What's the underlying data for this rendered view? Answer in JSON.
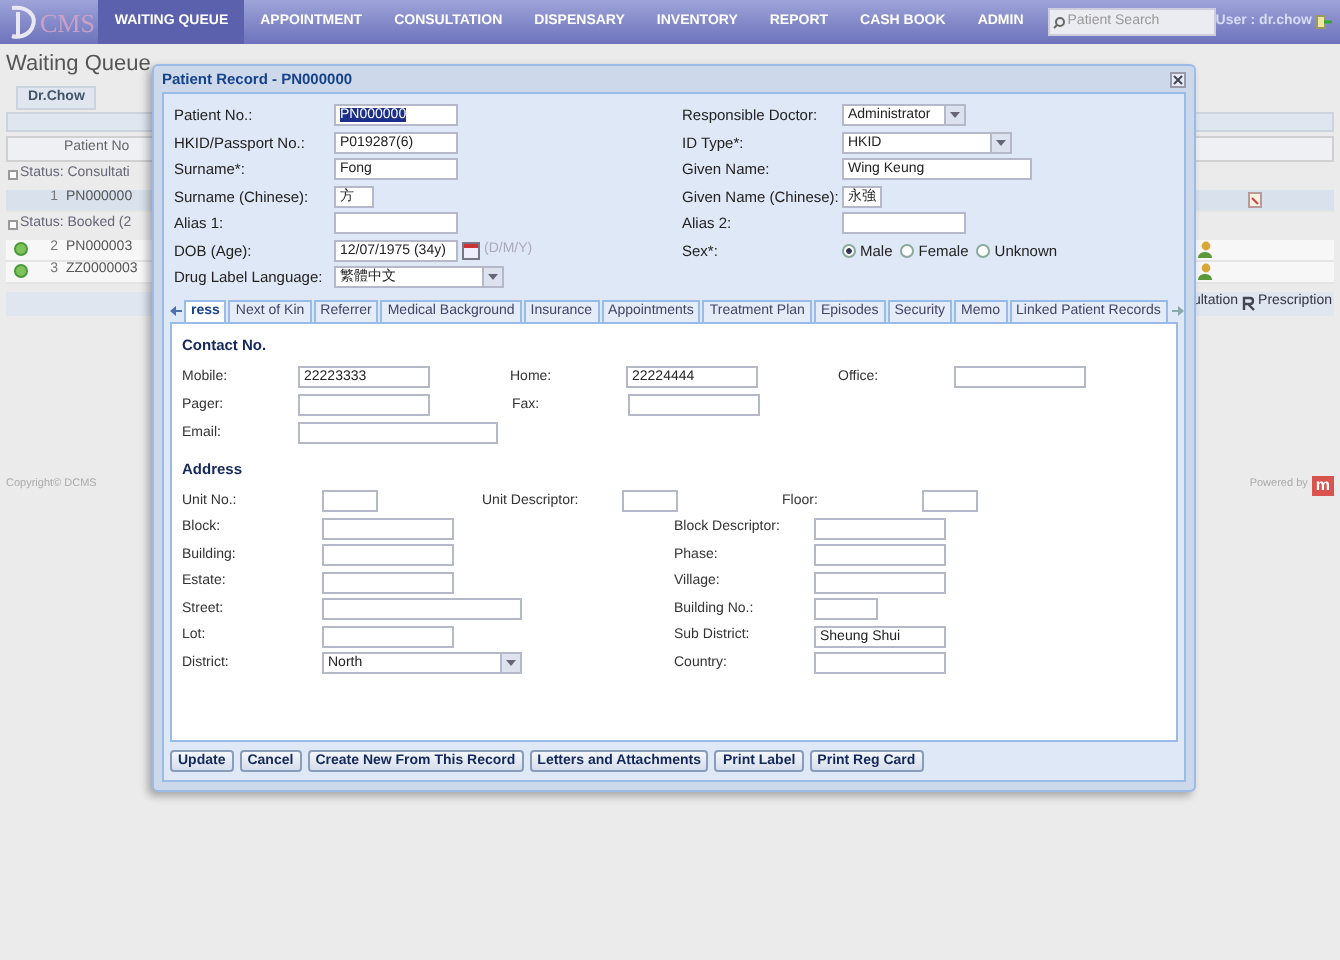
{
  "header": {
    "logo": "CMS",
    "nav": [
      {
        "label": "WAITING QUEUE",
        "selected": true
      },
      {
        "label": "APPOINTMENT",
        "selected": false
      },
      {
        "label": "CONSULTATION",
        "selected": false
      },
      {
        "label": "DISPENSARY",
        "selected": false
      },
      {
        "label": "INVENTORY",
        "selected": false
      },
      {
        "label": "REPORT",
        "selected": false
      },
      {
        "label": "CASH BOOK",
        "selected": false
      },
      {
        "label": "ADMIN",
        "selected": false
      }
    ],
    "search": {
      "placeholder": "Patient Search"
    },
    "user": "User : dr.chow"
  },
  "page": {
    "title": "Waiting Queue",
    "tabs": [
      {
        "label": "Dr.Chow",
        "selected": true
      }
    ],
    "grid": {
      "column": "Patient No",
      "groups": [
        {
          "title": "Status: Consultati",
          "rows": [
            {
              "number": "1",
              "patient_no": "PN000000",
              "selected": true,
              "kind": "note"
            }
          ]
        },
        {
          "title": "Status: Booked (2",
          "rows": [
            {
              "number": "2",
              "patient_no": "PN000003",
              "selected": false,
              "kind": "person"
            },
            {
              "number": "3",
              "patient_no": "ZZ0000003",
              "selected": false,
              "kind": "person"
            }
          ]
        }
      ],
      "toolbar": [
        "ultation",
        "Prescription"
      ]
    },
    "footer": {
      "copyright": "Copyright© DCMS",
      "powered": "Powered by",
      "brand": "m"
    }
  },
  "dialog": {
    "title": "Patient Record - PN000000",
    "left_fields": [
      {
        "label": "Patient No.:",
        "value": "PN000000",
        "kind": "text",
        "text_selected": true
      },
      {
        "label": "HKID/Passport No.:",
        "value": "P019287(6)",
        "kind": "text"
      },
      {
        "label": "Surname*:",
        "value": "Fong",
        "kind": "text"
      },
      {
        "label": "Surname (Chinese):",
        "value": "方",
        "kind": "text"
      },
      {
        "label": "Alias 1:",
        "kind": "text"
      },
      {
        "label": "DOB (Age):",
        "value": "12/07/1975 (34y)",
        "hint": "(D/M/Y)",
        "kind": "date"
      },
      {
        "label": "Drug Label Language:",
        "value": "繁體中文",
        "kind": "select"
      }
    ],
    "right_fields": [
      {
        "label": "Responsible Doctor:",
        "value": "Administrator",
        "kind": "select"
      },
      {
        "label": "ID Type*:",
        "value": "HKID",
        "kind": "select"
      },
      {
        "label": "Given Name:",
        "value": "Wing Keung",
        "kind": "text"
      },
      {
        "label": "Given Name (Chinese):",
        "value": "永強",
        "kind": "text"
      },
      {
        "label": "Alias 2:",
        "kind": "text"
      },
      {
        "label": "Sex*:",
        "kind": "radio",
        "options": [
          {
            "label": "Male",
            "selected": true
          },
          {
            "label": "Female",
            "selected": false
          },
          {
            "label": "Unknown",
            "selected": false
          }
        ]
      }
    ],
    "tabs": [
      {
        "label": "ress",
        "selected": true
      },
      {
        "label": "Next of Kin",
        "selected": false
      },
      {
        "label": "Referrer",
        "selected": false
      },
      {
        "label": "Medical Background",
        "selected": false
      },
      {
        "label": "Insurance",
        "selected": false
      },
      {
        "label": "Appointments",
        "selected": false
      },
      {
        "label": "Treatment Plan",
        "selected": false
      },
      {
        "label": "Episodes",
        "selected": false
      },
      {
        "label": "Security",
        "selected": false
      },
      {
        "label": "Memo",
        "selected": false
      },
      {
        "label": "Linked Patient Records",
        "selected": false
      }
    ],
    "contact": {
      "title": "Contact No.",
      "rows": [
        [
          {
            "label": "Mobile:",
            "value": "22223333"
          },
          {
            "label": "Home:",
            "value": "22224444"
          },
          {
            "label": "Office:"
          }
        ],
        [
          {
            "label": "Pager:"
          },
          {
            "label": "Fax:"
          }
        ],
        [
          {
            "label": "Email:"
          }
        ]
      ]
    },
    "address": {
      "title": "Address",
      "rows": [
        [
          {
            "label": "Unit No.:"
          },
          {
            "label": "Unit Descriptor:"
          },
          {
            "label": "Floor:"
          }
        ],
        [
          {
            "label": "Block:"
          },
          {
            "label": "Block Descriptor:"
          }
        ],
        [
          {
            "label": "Building:"
          },
          {
            "label": "Phase:"
          }
        ],
        [
          {
            "label": "Estate:"
          },
          {
            "label": "Village:"
          }
        ],
        [
          {
            "label": "Street:"
          },
          {
            "label": "Building No.:"
          }
        ],
        [
          {
            "label": "Lot:"
          },
          {
            "label": "Sub District:",
            "value": "Sheung Shui"
          }
        ],
        [
          {
            "label": "District:",
            "value": "North",
            "kind": "select"
          },
          {
            "label": "Country:"
          }
        ]
      ]
    },
    "buttons": [
      "Update",
      "Cancel",
      "Create New From This Record",
      "Letters and Attachments",
      "Print Label",
      "Print Reg Card"
    ]
  }
}
